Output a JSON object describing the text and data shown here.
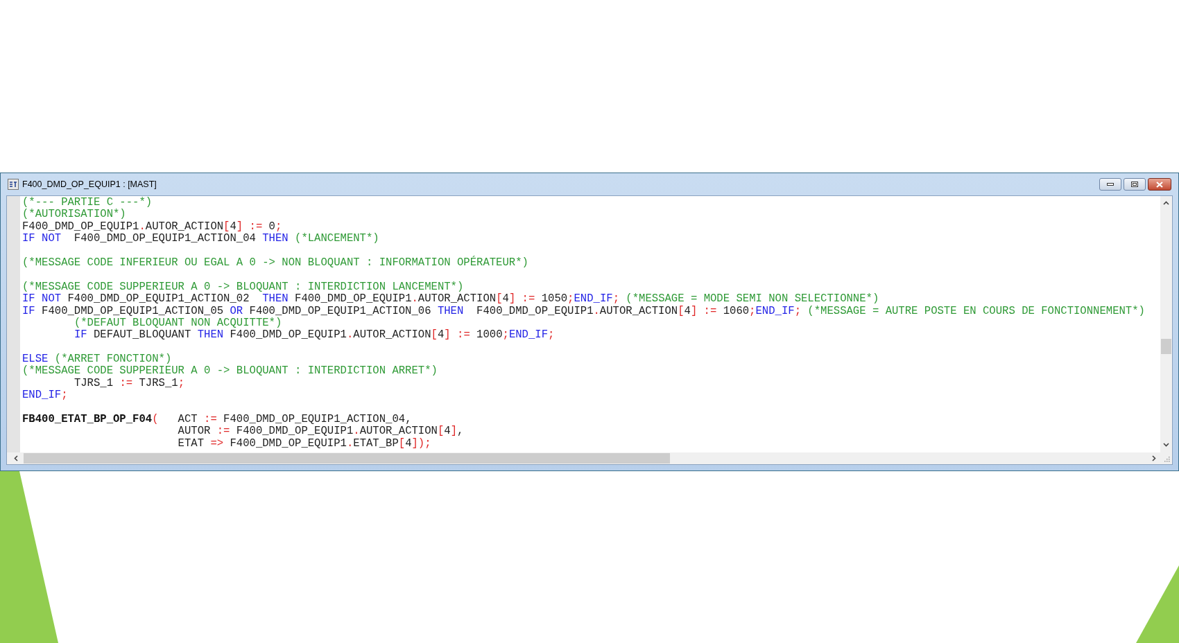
{
  "window": {
    "title": "F400_DMD_OP_EQUIP1 : [MAST]"
  },
  "editor": {
    "lines": [
      {
        "kind": "code",
        "tokens": [
          {
            "kind": "cm",
            "text": "(*--- PARTIE C ---*)"
          }
        ]
      },
      {
        "kind": "code",
        "tokens": [
          {
            "kind": "cm",
            "text": "(*AUTORISATION*)"
          }
        ]
      },
      {
        "kind": "code",
        "tokens": [
          {
            "kind": "id",
            "text": "F400_DMD_OP_EQUIP1"
          },
          {
            "kind": "op",
            "text": "."
          },
          {
            "kind": "id",
            "text": "AUTOR_ACTION"
          },
          {
            "kind": "op",
            "text": "["
          },
          {
            "kind": "id",
            "text": "4"
          },
          {
            "kind": "op",
            "text": "] :="
          },
          {
            "kind": "id",
            "text": " 0"
          },
          {
            "kind": "op",
            "text": ";"
          }
        ]
      },
      {
        "kind": "code",
        "tokens": [
          {
            "kind": "kw",
            "text": "IF NOT"
          },
          {
            "kind": "id",
            "text": "  F400_DMD_OP_EQUIP1_ACTION_04 "
          },
          {
            "kind": "kw",
            "text": "THEN "
          },
          {
            "kind": "cm",
            "text": "(*LANCEMENT*)"
          }
        ]
      },
      {
        "kind": "blank"
      },
      {
        "kind": "code",
        "tokens": [
          {
            "kind": "cm",
            "text": "(*MESSAGE CODE INFERIEUR OU EGAL A 0 -> NON BLOQUANT : INFORMATION OPÉRATEUR*)"
          }
        ]
      },
      {
        "kind": "blank"
      },
      {
        "kind": "code",
        "tokens": [
          {
            "kind": "cm",
            "text": "(*MESSAGE CODE SUPPERIEUR A 0 -> BLOQUANT : INTERDICTION LANCEMENT*)"
          }
        ]
      },
      {
        "kind": "code",
        "tokens": [
          {
            "kind": "kw",
            "text": "IF NOT"
          },
          {
            "kind": "id",
            "text": " F400_DMD_OP_EQUIP1_ACTION_02  "
          },
          {
            "kind": "kw",
            "text": "THEN"
          },
          {
            "kind": "id",
            "text": " F400_DMD_OP_EQUIP1"
          },
          {
            "kind": "op",
            "text": "."
          },
          {
            "kind": "id",
            "text": "AUTOR_ACTION"
          },
          {
            "kind": "op",
            "text": "["
          },
          {
            "kind": "id",
            "text": "4"
          },
          {
            "kind": "op",
            "text": "] :="
          },
          {
            "kind": "id",
            "text": " 1050"
          },
          {
            "kind": "op",
            "text": ";"
          },
          {
            "kind": "kw",
            "text": "END_IF"
          },
          {
            "kind": "op",
            "text": "; "
          },
          {
            "kind": "cm",
            "text": "(*MESSAGE = MODE SEMI NON SELECTIONNE*)"
          }
        ]
      },
      {
        "kind": "code",
        "tokens": [
          {
            "kind": "kw",
            "text": "IF"
          },
          {
            "kind": "id",
            "text": " F400_DMD_OP_EQUIP1_ACTION_05 "
          },
          {
            "kind": "kw",
            "text": "OR"
          },
          {
            "kind": "id",
            "text": " F400_DMD_OP_EQUIP1_ACTION_06 "
          },
          {
            "kind": "kw",
            "text": "THEN"
          },
          {
            "kind": "id",
            "text": "  F400_DMD_OP_EQUIP1"
          },
          {
            "kind": "op",
            "text": "."
          },
          {
            "kind": "id",
            "text": "AUTOR_ACTION"
          },
          {
            "kind": "op",
            "text": "["
          },
          {
            "kind": "id",
            "text": "4"
          },
          {
            "kind": "op",
            "text": "] :="
          },
          {
            "kind": "id",
            "text": " 1060"
          },
          {
            "kind": "op",
            "text": ";"
          },
          {
            "kind": "kw",
            "text": "END_IF"
          },
          {
            "kind": "op",
            "text": "; "
          },
          {
            "kind": "cm",
            "text": "(*MESSAGE = AUTRE POSTE EN COURS DE FONCTIONNEMENT*)"
          }
        ]
      },
      {
        "kind": "code",
        "tokens": [
          {
            "kind": "cm",
            "text": "        (*DEFAUT BLOQUANT NON ACQUITTE*)"
          }
        ]
      },
      {
        "kind": "code",
        "tokens": [
          {
            "kind": "kw",
            "text": "        IF"
          },
          {
            "kind": "id",
            "text": " DEFAUT_BLOQUANT "
          },
          {
            "kind": "kw",
            "text": "THEN"
          },
          {
            "kind": "id",
            "text": " F400_DMD_OP_EQUIP1"
          },
          {
            "kind": "op",
            "text": "."
          },
          {
            "kind": "id",
            "text": "AUTOR_ACTION"
          },
          {
            "kind": "op",
            "text": "["
          },
          {
            "kind": "id",
            "text": "4"
          },
          {
            "kind": "op",
            "text": "] :="
          },
          {
            "kind": "id",
            "text": " 1000"
          },
          {
            "kind": "op",
            "text": ";"
          },
          {
            "kind": "kw",
            "text": "END_IF"
          },
          {
            "kind": "op",
            "text": ";"
          }
        ]
      },
      {
        "kind": "blank"
      },
      {
        "kind": "code",
        "tokens": [
          {
            "kind": "kw",
            "text": "ELSE "
          },
          {
            "kind": "cm",
            "text": "(*ARRET FONCTION*)"
          }
        ]
      },
      {
        "kind": "code",
        "tokens": [
          {
            "kind": "cm",
            "text": "(*MESSAGE CODE SUPPERIEUR A 0 -> BLOQUANT : INTERDICTION ARRET*)"
          }
        ]
      },
      {
        "kind": "code",
        "tokens": [
          {
            "kind": "id",
            "text": "        TJRS_1 "
          },
          {
            "kind": "op",
            "text": ":="
          },
          {
            "kind": "id",
            "text": " TJRS_1"
          },
          {
            "kind": "op",
            "text": ";"
          }
        ]
      },
      {
        "kind": "code",
        "tokens": [
          {
            "kind": "kw",
            "text": "END_IF"
          },
          {
            "kind": "op",
            "text": ";"
          }
        ]
      },
      {
        "kind": "blank"
      },
      {
        "kind": "code",
        "tokens": [
          {
            "kind": "fb",
            "text": "FB400_ETAT_BP_OP_F04"
          },
          {
            "kind": "op",
            "text": "("
          },
          {
            "kind": "id",
            "text": "   ACT "
          },
          {
            "kind": "op",
            "text": ":="
          },
          {
            "kind": "id",
            "text": " F400_DMD_OP_EQUIP1_ACTION_04,"
          }
        ]
      },
      {
        "kind": "code",
        "tokens": [
          {
            "kind": "id",
            "text": "                        AUTOR "
          },
          {
            "kind": "op",
            "text": ":="
          },
          {
            "kind": "id",
            "text": " F400_DMD_OP_EQUIP1"
          },
          {
            "kind": "op",
            "text": "."
          },
          {
            "kind": "id",
            "text": "AUTOR_ACTION"
          },
          {
            "kind": "op",
            "text": "["
          },
          {
            "kind": "id",
            "text": "4"
          },
          {
            "kind": "op",
            "text": "]"
          },
          {
            "kind": "id",
            "text": ","
          }
        ]
      },
      {
        "kind": "code",
        "tokens": [
          {
            "kind": "id",
            "text": "                        ETAT "
          },
          {
            "kind": "op",
            "text": "=>"
          },
          {
            "kind": "id",
            "text": " F400_DMD_OP_EQUIP1"
          },
          {
            "kind": "op",
            "text": "."
          },
          {
            "kind": "id",
            "text": "ETAT_BP"
          },
          {
            "kind": "op",
            "text": "["
          },
          {
            "kind": "id",
            "text": "4"
          },
          {
            "kind": "op",
            "text": "]);"
          }
        ]
      }
    ]
  }
}
